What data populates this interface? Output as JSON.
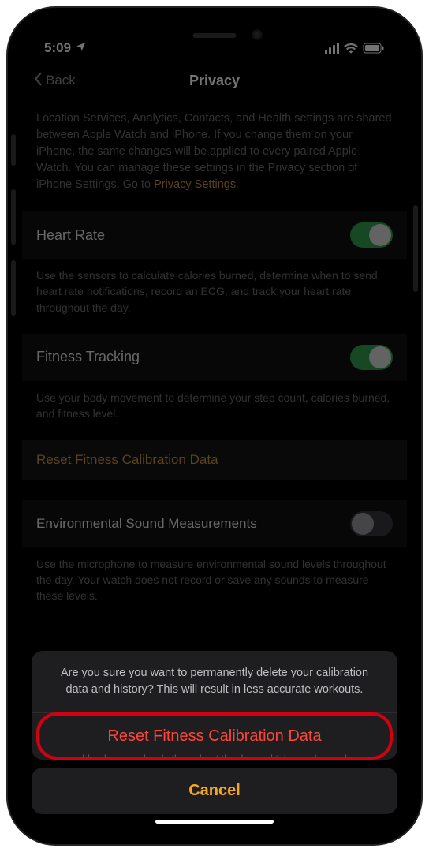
{
  "status": {
    "time": "5:09"
  },
  "nav": {
    "back": "Back",
    "title": "Privacy"
  },
  "intro": {
    "text": "Location Services, Analytics, Contacts, and Health settings are shared between Apple Watch and iPhone. If you change them on your iPhone, the same changes will be applied to every paired Apple Watch. You can manage these settings in the Privacy section of iPhone Settings. Go to ",
    "link": "Privacy Settings"
  },
  "sections": {
    "heart_rate": {
      "label": "Heart Rate",
      "enabled": true,
      "footer": "Use the sensors to calculate calories burned, determine when to send heart rate notifications, record an ECG, and track your heart rate throughout the day."
    },
    "fitness_tracking": {
      "label": "Fitness Tracking",
      "enabled": true,
      "footer": "Use your body movement to determine your step count, calories burned, and fitness level."
    },
    "reset_calibration": {
      "label": "Reset Fitness Calibration Data"
    },
    "environmental_sound": {
      "label": "Environmental Sound Measurements",
      "enabled": false,
      "footer": "Use the microphone to measure environmental sound levels throughout the day. Your watch does not record or save any sounds to measure these levels."
    }
  },
  "sheet": {
    "message": "Are you sure you want to permanently delete your calibration data and history? This will result in less accurate workouts.",
    "destructive": "Reset Fitness Calibration Data",
    "behind_text": "blood oxygen levels throughout the day and take on-demand",
    "cancel": "Cancel"
  }
}
